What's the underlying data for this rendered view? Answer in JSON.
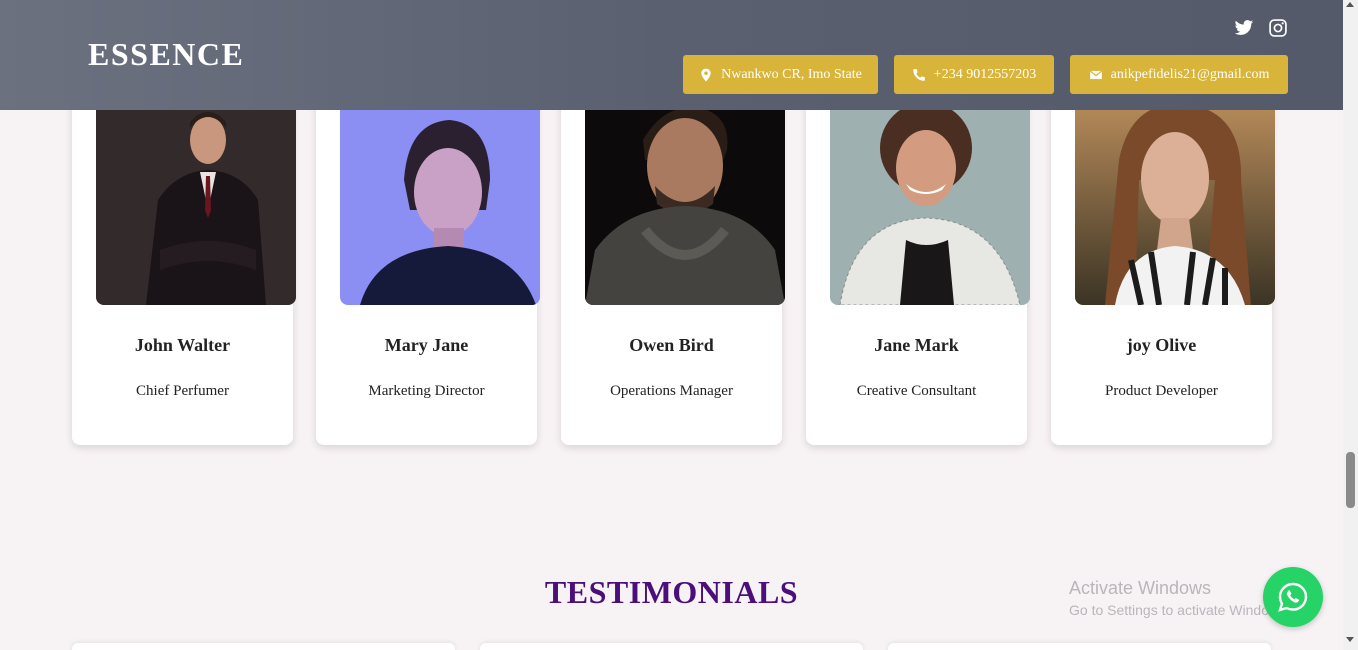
{
  "header": {
    "brand": "ESSENCE",
    "address": "Nwankwo CR, Imo State",
    "phone": "+234 9012557203",
    "email": "anikpefidelis21@gmail.com",
    "social": [
      "twitter-icon",
      "instagram-icon"
    ]
  },
  "team": [
    {
      "name": "John Walter",
      "role": "Chief Perfumer"
    },
    {
      "name": "Mary Jane",
      "role": "Marketing Director"
    },
    {
      "name": "Owen Bird",
      "role": "Operations Manager"
    },
    {
      "name": "Jane Mark",
      "role": "Creative Consultant"
    },
    {
      "name": "joy Olive",
      "role": "Product Developer"
    }
  ],
  "testimonials": {
    "title": "TESTIMONIALS"
  },
  "watermark": {
    "line1": "Activate Windows",
    "line2": "Go to Settings to activate Windows."
  },
  "colors": {
    "header": "#5d6373",
    "accent": "#d8b43a",
    "title": "#4b0f7a",
    "whatsapp": "#25d366"
  }
}
